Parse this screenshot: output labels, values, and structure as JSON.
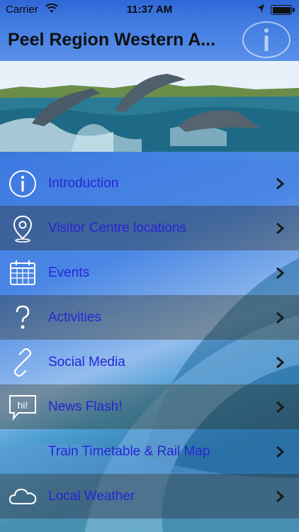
{
  "status_bar": {
    "carrier": "Carrier",
    "time": "11:37 AM",
    "wifi_icon": "wifi-icon",
    "location_icon": "location-arrow-icon",
    "battery_icon": "battery-icon",
    "battery_level": 1.0
  },
  "nav": {
    "title": "Peel Region Western A...",
    "info_icon": "info-icon"
  },
  "hero": {
    "image": "dolphins-leaping-photo"
  },
  "menu": [
    {
      "label": "Introduction",
      "icon": "info-circle-icon"
    },
    {
      "label": "Visitor Centre locations",
      "icon": "map-pin-icon"
    },
    {
      "label": "Events",
      "icon": "calendar-icon"
    },
    {
      "label": "Activities",
      "icon": "question-icon"
    },
    {
      "label": "Social Media",
      "icon": "link-icon"
    },
    {
      "label": "News Flash!",
      "icon": "hi-speech-bubble-icon"
    },
    {
      "label": "Train Timetable & Rail Map",
      "icon": ""
    },
    {
      "label": "Local Weather",
      "icon": "cloud-icon"
    }
  ],
  "colors": {
    "menu_label": "#2626d6",
    "nav_background": "#3f7ae0"
  }
}
